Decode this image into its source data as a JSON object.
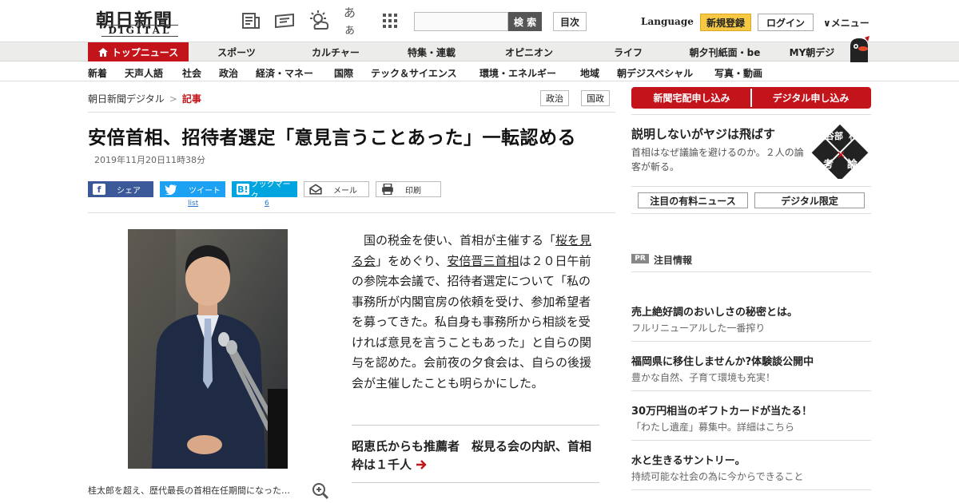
{
  "header": {
    "logo_main": "朝日新聞",
    "logo_sub": "DIGITAL",
    "icon_kana": "あぁ",
    "search_placeholder": "",
    "search_label": "検 索",
    "toc_label": "目次",
    "language_label": "Language",
    "register_label": "新規登録",
    "login_label": "ログイン",
    "menu_label": "∨メニュー"
  },
  "nav_primary": [
    "トップニュース",
    "スポーツ",
    "カルチャー",
    "特集・連載",
    "オピニオン",
    "ライフ",
    "朝夕刊紙面・be",
    "MY朝デジ"
  ],
  "nav_secondary": [
    "新着",
    "天声人語",
    "社会",
    "政治",
    "経済・マネー",
    "国際",
    "テック＆サイエンス",
    "環境・エネルギー",
    "地域",
    "朝デジスペシャル",
    "写真・動画"
  ],
  "breadcrumb": {
    "home": "朝日新聞デジタル",
    "separator": ">",
    "current": "記事"
  },
  "tags": [
    "政治",
    "国政"
  ],
  "article": {
    "headline": "安倍首相、招待者選定「意見言うことあった」一転認める",
    "date": "2019年11月20日11時38分",
    "share": {
      "facebook": "シェア",
      "twitter": "ツイート",
      "hatena": "ブックマーク",
      "mail": "メール",
      "print": "印刷",
      "twitter_count": "list",
      "hatena_count": "6"
    },
    "body_before_link1": "　国の税金を使い、首相が主催する「",
    "link1": "桜を見る会",
    "body_mid": "」をめぐり、",
    "link2": "安倍晋三首相",
    "body_after": "は２０日午前の参院本会議で、招待者選定について「私の事務所が内閣官房の依頼を受け、参加希望者を募ってきた。私自身も事務所から相談を受ければ意見を言うこともあった」と自らの関与を認めた。会前夜の夕食会は、自らの後援会が主催したことも明らかにした。",
    "related": "昭恵氏からも推薦者　桜見る会の内訳、首相枠は１千人",
    "caption": "桂太郎を超え、歴代最長の首相在任期間になった…"
  },
  "sidebar": {
    "subscribe_paper": "新聞宅配申し込み",
    "subscribe_digital": "デジタル申し込み",
    "promo_title": "説明しないがヤジは飛ばす",
    "promo_desc": "首相はなぜ議論を避けるのか。２人の論客が斬る。",
    "promo_badge": "長谷部 杉田 考×論",
    "btn_paid_news": "注目の有料ニュース",
    "btn_digital_only": "デジタル限定",
    "pr_badge": "PR",
    "pr_heading": "注目情報",
    "pr_items": [
      {
        "title": "売上絶好調のおいしさの秘密とは。",
        "desc": "フルリニューアルした一番搾り"
      },
      {
        "title": "福岡県に移住しませんか?体験談公開中",
        "desc": "豊かな自然、子育て環境も充実！"
      },
      {
        "title": "30万円相当のギフトカードが当たる！",
        "desc": "「わたし遺産」募集中。詳細はこちら"
      },
      {
        "title": "水と生きるサントリー。",
        "desc": "持続可能な社会の為に今からできること"
      }
    ]
  },
  "colors": {
    "brand_red": "#c3141b",
    "register_yellow": "#f6c844",
    "facebook": "#3b5998",
    "twitter": "#1da1f2",
    "hatena": "#00a4de"
  }
}
